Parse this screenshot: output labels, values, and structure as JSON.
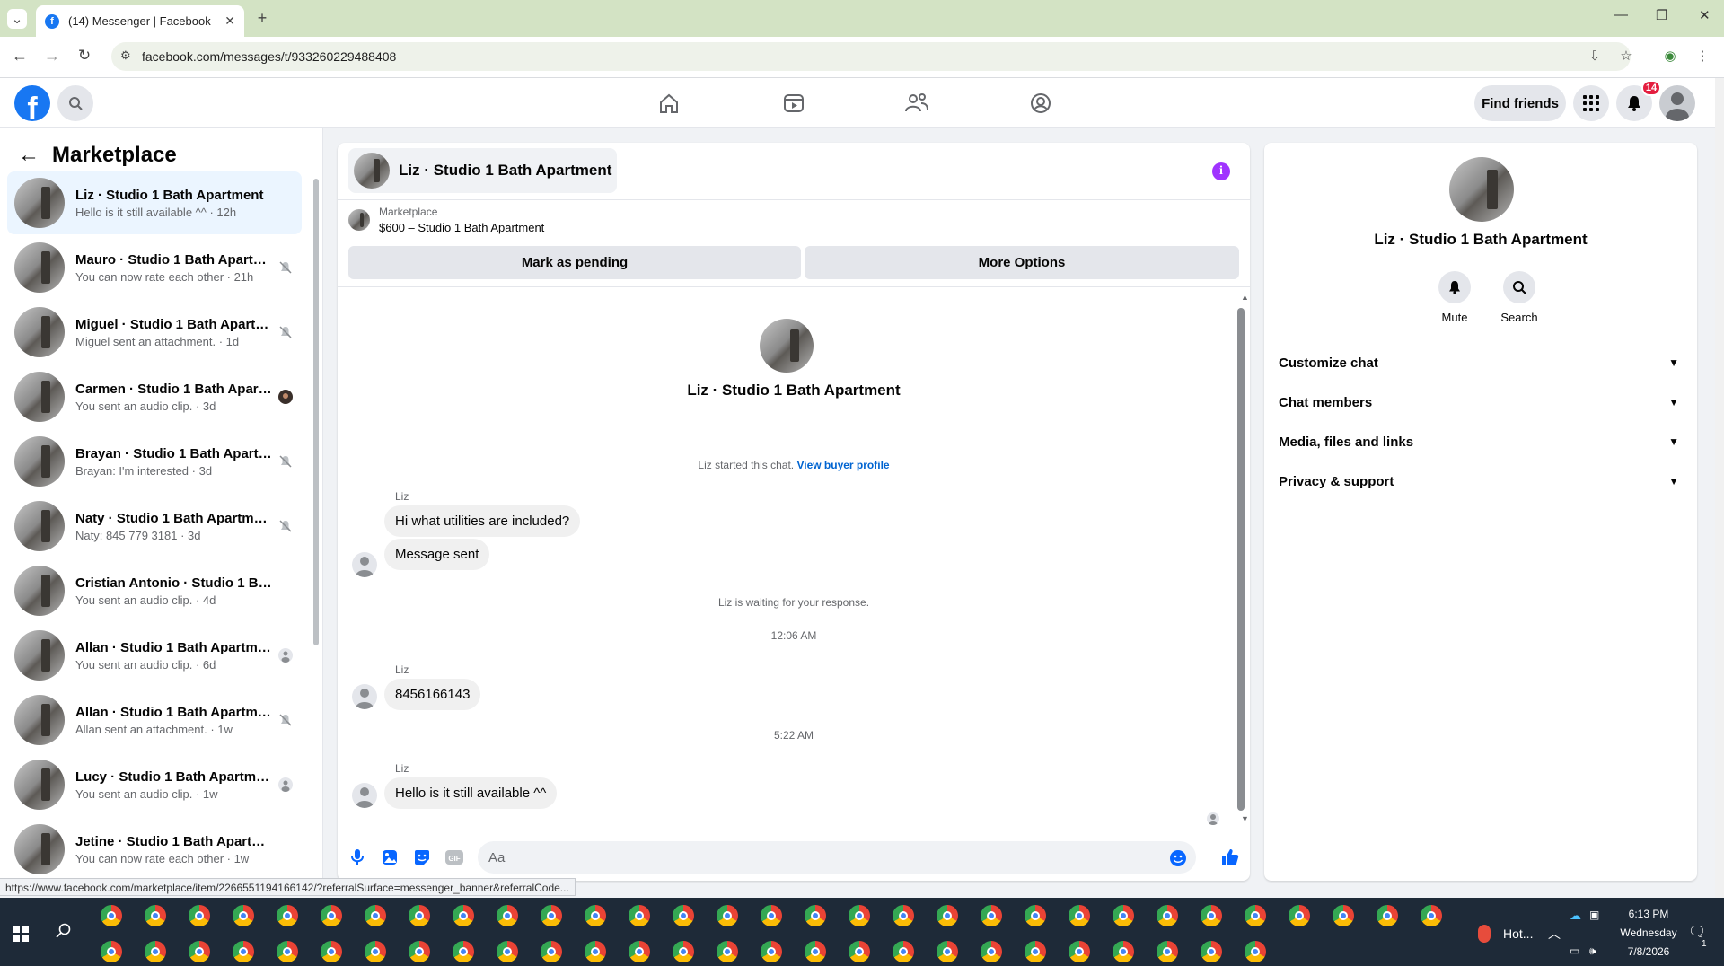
{
  "browser": {
    "tab_title": "(14) Messenger | Facebook",
    "url": "facebook.com/messages/t/933260229488408",
    "status_url": "https://www.facebook.com/marketplace/item/2266551194166142/?referralSurface=messenger_banner&referralCode..."
  },
  "fb": {
    "find_friends": "Find friends",
    "notification_count": "14"
  },
  "sidebar": {
    "title": "Marketplace",
    "conversations": [
      {
        "name": "Liz · Studio 1 Bath Apartment",
        "preview": "Hello is it still available ^^ · 12h",
        "state": "none"
      },
      {
        "name": "Mauro · Studio 1 Bath Apartm...",
        "preview": "You can now rate each other · 21h",
        "state": "muted"
      },
      {
        "name": "Miguel · Studio 1 Bath Apartm...",
        "preview": "Miguel sent an attachment. · 1d",
        "state": "muted"
      },
      {
        "name": "Carmen · Studio 1 Bath Apart...",
        "preview": "You sent an audio clip. · 3d",
        "state": "seen"
      },
      {
        "name": "Brayan · Studio 1 Bath Apartm...",
        "preview": "Brayan: I'm interested · 3d",
        "state": "muted"
      },
      {
        "name": "Naty · Studio 1 Bath Apartment",
        "preview": "Naty: 845 779 3181 · 3d",
        "state": "muted"
      },
      {
        "name": "Cristian Antonio · Studio 1 Bath ...",
        "preview": "You sent an audio clip. · 4d",
        "state": "none"
      },
      {
        "name": "Allan · Studio 1 Bath Apartment",
        "preview": "You sent an audio clip. · 6d",
        "state": "delivered"
      },
      {
        "name": "Allan · Studio 1 Bath Apartment",
        "preview": "Allan sent an attachment. · 1w",
        "state": "muted"
      },
      {
        "name": "Lucy · Studio 1 Bath Apartment",
        "preview": "You sent an audio clip. · 1w",
        "state": "delivered"
      },
      {
        "name": "Jetine · Studio 1 Bath Apartment",
        "preview": "You can now rate each other · 1w",
        "state": "none"
      }
    ]
  },
  "chat": {
    "title": "Liz · Studio 1 Bath Apartment",
    "marketplace_label": "Marketplace",
    "listing": "$600 – Studio 1 Bath Apartment",
    "mark_pending": "Mark as pending",
    "more_options": "More Options",
    "intro_name": "Liz · Studio 1 Bath Apartment",
    "started_text": "Liz started this chat.",
    "view_profile": "View buyer profile",
    "messages": [
      {
        "sender": "Liz",
        "text": "Hi what utilities are included?"
      },
      {
        "text": "Message sent"
      },
      {
        "sender": "Liz",
        "text": "8456166143"
      },
      {
        "sender": "Liz",
        "text": "Hello is it still available ^^"
      }
    ],
    "waiting_text": "Liz is waiting for your response.",
    "time1": "12:06 AM",
    "time2": "5:22 AM",
    "composer_placeholder": "Aa"
  },
  "details": {
    "name": "Liz · Studio 1 Bath Apartment",
    "mute": "Mute",
    "search": "Search",
    "rows": [
      "Customize chat",
      "Chat members",
      "Media, files and links",
      "Privacy & support"
    ]
  },
  "taskbar": {
    "weather": "Hot...",
    "time": "6:13 PM",
    "day": "Wednesday",
    "date": "7/8/2026",
    "notif_count": "1"
  },
  "colors": {
    "brand": "#1877f2",
    "accent_purple": "#a033ff",
    "badge_red": "#e41e3f"
  }
}
